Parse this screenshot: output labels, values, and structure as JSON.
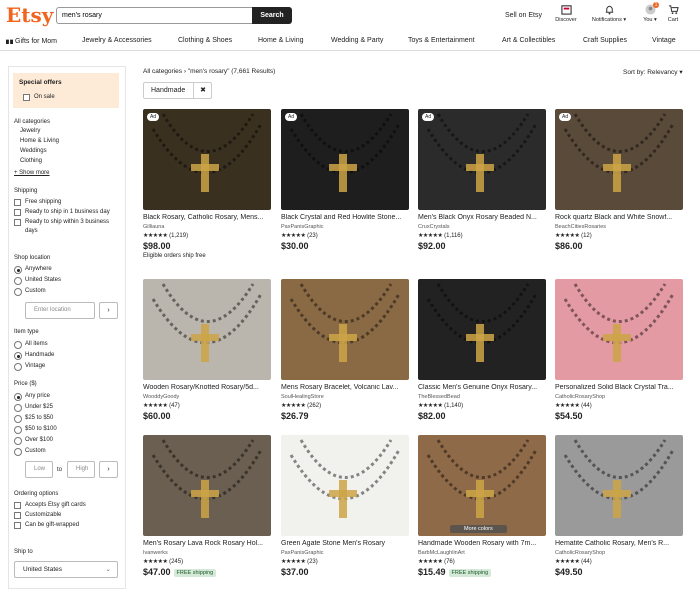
{
  "header": {
    "logo": "Etsy",
    "search_value": "men's rosary",
    "search_button": "Search",
    "sell": "Sell on Etsy",
    "icons": [
      {
        "name": "discover-icon",
        "label": "Discover"
      },
      {
        "name": "bell-icon",
        "label": "Notifications ▾"
      },
      {
        "name": "avatar-icon",
        "label": "You ▾",
        "badge": "1"
      },
      {
        "name": "cart-icon",
        "label": "Cart"
      }
    ]
  },
  "nav": [
    "Gifts for Mom",
    "Jewelry & Accessories",
    "Clothing & Shoes",
    "Home & Living",
    "Wedding & Party",
    "Toys & Entertainment",
    "Art & Collectibles",
    "Craft Supplies",
    "Vintage"
  ],
  "breadcrumb": {
    "all": "All categories",
    "sep": "›",
    "query": "\"men's rosary\"",
    "count": "(7,661 Results)"
  },
  "sort": "Sort by: Relevancy ▾",
  "chip": {
    "label": "Handmade",
    "close": "✖"
  },
  "sidebar": {
    "special_title": "Special offers",
    "on_sale": "On sale",
    "cat_title": "All categories",
    "categories": [
      "Jewelry",
      "Home & Living",
      "Weddings",
      "Clothing"
    ],
    "show_more": "+ Show more",
    "shipping_title": "Shipping",
    "shipping": [
      "Free shipping",
      "Ready to ship in 1 business day",
      "Ready to ship within 3 business",
      "days"
    ],
    "location_title": "Shop location",
    "locations": [
      "Anywhere",
      "United States",
      "Custom"
    ],
    "location_placeholder": "Enter location",
    "item_type_title": "Item type",
    "item_types": [
      "All items",
      "Handmade",
      "Vintage"
    ],
    "price_title": "Price ($)",
    "prices": [
      "Any price",
      "Under $25",
      "$25 to $50",
      "$50 to $100",
      "Over $100",
      "Custom"
    ],
    "low": "Low",
    "to": "to",
    "high": "High",
    "go": "›",
    "ordering_title": "Ordering options",
    "ordering": [
      "Accepts Etsy gift cards",
      "Customizable",
      "Can be gift-wrapped"
    ],
    "ship_to_title": "Ship to",
    "ship_to": "United States"
  },
  "products": [
    {
      "title": "Black Rosary, Catholic Rosary, Mens...",
      "shop": "Gilliauna",
      "stars": "★★★★★",
      "reviews": "(1,219)",
      "price": "$98.00",
      "ad": "Ad",
      "note": "Eligible orders ship free",
      "free": "",
      "more": "",
      "bg": "#3a3020"
    },
    {
      "title": "Black Crystal and Red Howlite Stone...",
      "shop": "PaxPanisGraphic",
      "stars": "★★★★★",
      "reviews": "(23)",
      "price": "$30.00",
      "ad": "Ad",
      "note": "",
      "free": "",
      "more": "",
      "bg": "#1e1e1e"
    },
    {
      "title": "Men's Black Onyx Rosary Beaded N...",
      "shop": "CruxCrystals",
      "stars": "★★★★★",
      "reviews": "(1,116)",
      "price": "$92.00",
      "ad": "Ad",
      "note": "",
      "free": "",
      "more": "",
      "bg": "#2b2b2b"
    },
    {
      "title": "Rock quartz Black and White Snowf...",
      "shop": "BeachCitiesRosaries",
      "stars": "★★★★★",
      "reviews": "(12)",
      "price": "$86.00",
      "ad": "Ad",
      "note": "",
      "free": "",
      "more": "",
      "bg": "#5a4a3a"
    },
    {
      "title": "Wooden Rosary/Knotted Rosary/5d...",
      "shop": "WooddyGoody",
      "stars": "★★★★★",
      "reviews": "(47)",
      "price": "$60.00",
      "ad": "",
      "note": "",
      "free": "",
      "more": "",
      "bg": "#bab5ad"
    },
    {
      "title": "Mens Rosary Bracelet, Volcanic Lav...",
      "shop": "SoulHealingStore",
      "stars": "★★★★★",
      "reviews": "(262)",
      "price": "$26.79",
      "ad": "",
      "note": "",
      "free": "",
      "more": "",
      "bg": "#8a6a45"
    },
    {
      "title": "Classic Men's Genuine Onyx Rosary...",
      "shop": "TheBlessedBead",
      "stars": "★★★★★",
      "reviews": "(1,140)",
      "price": "$82.00",
      "ad": "",
      "note": "",
      "free": "",
      "more": "",
      "bg": "#222222"
    },
    {
      "title": "Personalized Solid Black Crystal Tra...",
      "shop": "CatholicRosaryShop",
      "stars": "★★★★★",
      "reviews": "(44)",
      "price": "$54.50",
      "ad": "",
      "note": "",
      "free": "",
      "more": "",
      "bg": "#e39aa2"
    },
    {
      "title": "Men's Rosary Lava Rock Rosary Hol...",
      "shop": "Ivanwerks",
      "stars": "★★★★★",
      "reviews": "(245)",
      "price": "$47.00",
      "ad": "",
      "note": "",
      "free": "FREE shipping",
      "more": "",
      "bg": "#6a5f50"
    },
    {
      "title": "Green Agate Stone Men's Rosary",
      "shop": "PaxPanisGraphic",
      "stars": "★★★★★",
      "reviews": "(23)",
      "price": "$37.00",
      "ad": "",
      "note": "",
      "free": "",
      "more": "",
      "bg": "#f1f1ee"
    },
    {
      "title": "Handmade Wooden Rosary with 7m...",
      "shop": "BarbMcLaughlinArt",
      "stars": "★★★★★",
      "reviews": "(76)",
      "price": "$15.49",
      "ad": "",
      "note": "",
      "free": "FREE shipping",
      "more": "More colors",
      "bg": "#8e6a48"
    },
    {
      "title": "Hematite Catholic Rosary, Men's R...",
      "shop": "CatholicRosaryShop",
      "stars": "★★★★★",
      "reviews": "(44)",
      "price": "$49.50",
      "ad": "",
      "note": "",
      "free": "",
      "more": "",
      "bg": "#9a9a9a"
    }
  ]
}
